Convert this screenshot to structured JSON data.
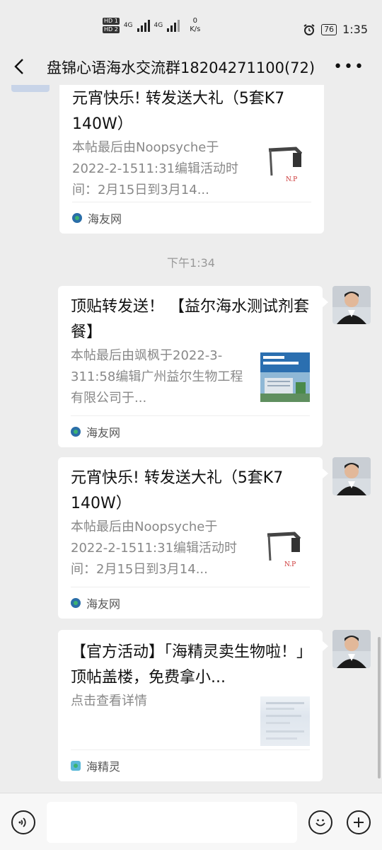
{
  "status_bar": {
    "hd1": "HD 1",
    "hd2": "HD 2",
    "net1": "4G",
    "net2": "4G",
    "speed_value": "0",
    "speed_unit": "K/s",
    "battery": "76",
    "time": "1:35"
  },
  "header": {
    "title": "盘锦心语海水交流群18204271100(72)"
  },
  "messages": [
    {
      "title": "元宵快乐! 转发送大礼（5套K7 140W）",
      "desc": "本帖最后由Noopsyche于2022-2-1511:31编辑活动时间：2月15日到3月14...",
      "source": "海友网",
      "thumb": "lamp-image"
    },
    {
      "title": "顶贴转发送！ 【益尔海水测试剂套餐】",
      "desc": "本帖最后由飒枫于2022-3-311:58编辑广州益尔生物工程有限公司于...",
      "source": "海友网",
      "thumb": "building-image"
    },
    {
      "title": "元宵快乐! 转发送大礼（5套K7 140W）",
      "desc": "本帖最后由Noopsyche于2022-2-1511:31编辑活动时间：2月15日到3月14...",
      "source": "海友网",
      "thumb": "lamp-image"
    },
    {
      "title": "【官方活动】「海精灵卖生物啦！」顶帖盖楼，免费拿小...",
      "desc": "点击查看详情",
      "source": "海精灵",
      "thumb": "blurred-image"
    }
  ],
  "time_divider": "下午1:34",
  "colors": {
    "background": "#ededed",
    "card": "#ffffff",
    "muted_text": "#888888"
  }
}
